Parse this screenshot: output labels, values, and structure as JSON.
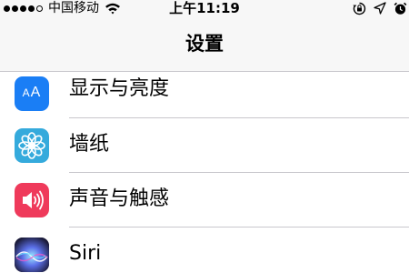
{
  "status_bar": {
    "carrier": "中国移动",
    "time": "上午11:19",
    "signal_bars_filled": 4,
    "signal_bars_total": 5,
    "icons": [
      "wifi-icon",
      "orientation-lock-icon",
      "location-arrow-icon",
      "alarm-clock-icon"
    ]
  },
  "nav": {
    "title": "设置"
  },
  "settings": {
    "items": [
      {
        "label": "显示与亮度",
        "icon": "display-brightness-icon",
        "icon_text": "AA",
        "icon_color": "#1a7ef5"
      },
      {
        "label": "墙纸",
        "icon": "wallpaper-flower-icon",
        "icon_color": "#35aadc"
      },
      {
        "label": "声音与触感",
        "icon": "speaker-icon",
        "icon_color": "#ef3a5b"
      },
      {
        "label": "Siri",
        "icon": "siri-icon",
        "icon_color": "#1b1b3a"
      }
    ]
  },
  "colors": {
    "bar_background": "#f7f7f7",
    "separator": "#c8c7cc"
  }
}
